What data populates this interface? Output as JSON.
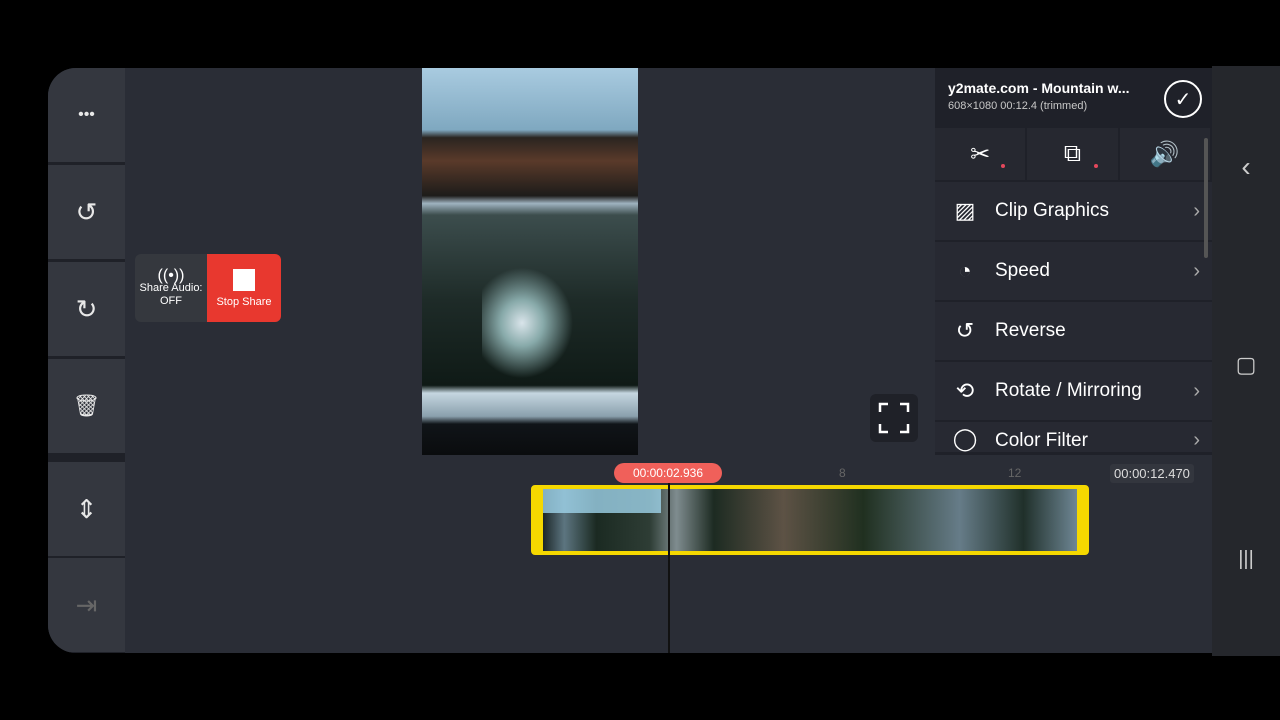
{
  "left_toolbar": {
    "more": "•••",
    "undo": "↺",
    "redo": "↻",
    "delete": "🗑",
    "layout": "⇕",
    "export": "⇥"
  },
  "share_overlay": {
    "audio_label": "Share Audio:",
    "audio_state": "OFF",
    "stop_label": "Stop Share"
  },
  "panel": {
    "title": "y2mate.com - Mountain w...",
    "subtitle": "608×1080  00:12.4 (trimmed)",
    "tabs": [
      {
        "icon": "scissors-icon",
        "glyph": "✂"
      },
      {
        "icon": "layers-icon",
        "glyph": "⧉"
      },
      {
        "icon": "volume-icon",
        "glyph": "🔊"
      }
    ],
    "items": [
      {
        "label": "Clip Graphics",
        "glyph": "▨",
        "chev": true
      },
      {
        "label": "Speed",
        "glyph": "◔",
        "chev": true
      },
      {
        "label": "Reverse",
        "glyph": "↺",
        "chev": false
      },
      {
        "label": "Rotate / Mirroring",
        "glyph": "⟲",
        "chev": true
      },
      {
        "label": "Color Filter",
        "glyph": "◯",
        "chev": true
      }
    ]
  },
  "timeline": {
    "current_time": "00:00:02.936",
    "end_time": "00:00:12.470",
    "ticks": [
      "8",
      "12"
    ]
  },
  "colors": {
    "accent_clip": "#f5d800",
    "playhead_pill": "#f0605a",
    "stop_share": "#e8382f"
  }
}
